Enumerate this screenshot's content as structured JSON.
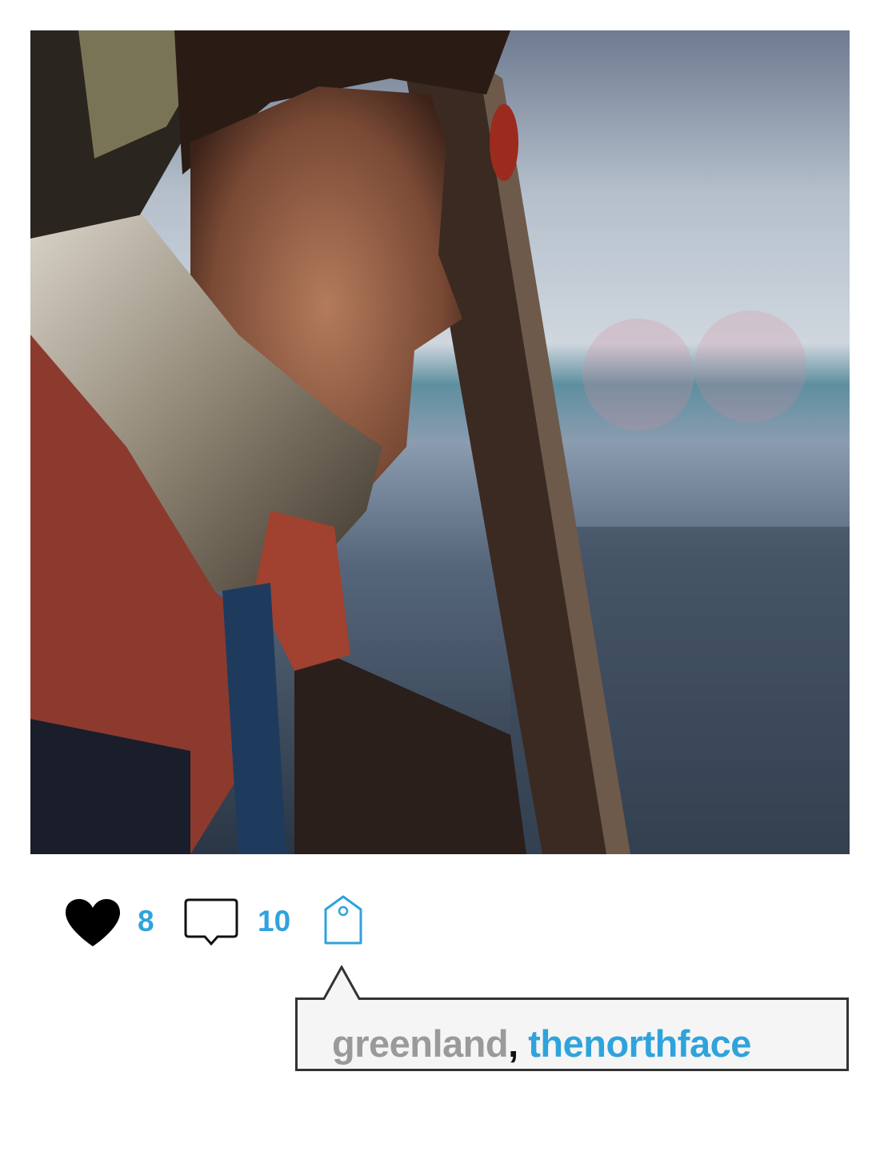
{
  "post": {
    "photo_alt": "",
    "likes": "8",
    "comments": "10"
  },
  "tags": {
    "first": "greenland",
    "separator": ", ",
    "second": "thenorthface"
  },
  "icons": {
    "like": "heart-icon",
    "comment": "speech-bubble-icon",
    "tag": "price-tag-icon"
  },
  "colors": {
    "accent": "#2fa3dc",
    "muted_tag": "#9a9a9a",
    "popover_bg": "#f5f5f5",
    "popover_border": "#333333"
  }
}
